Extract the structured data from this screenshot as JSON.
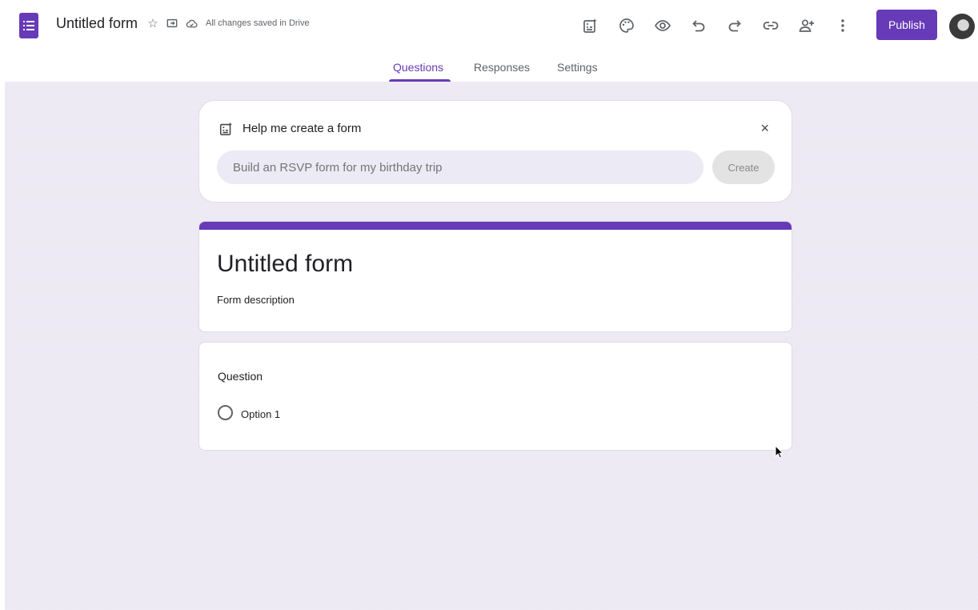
{
  "header": {
    "doc_title": "Untitled form",
    "save_status": "All changes saved in Drive",
    "publish_label": "Publish",
    "title_icons": [
      "star-icon",
      "move-to-folder-icon",
      "cloud-saved-icon"
    ],
    "tool_icons": [
      "ai-generate-icon",
      "palette-icon",
      "preview-eye-icon",
      "undo-icon",
      "redo-icon",
      "link-icon",
      "add-collaborator-icon",
      "more-vert-icon"
    ]
  },
  "tabs": [
    {
      "label": "Questions",
      "active": true
    },
    {
      "label": "Responses",
      "active": false
    },
    {
      "label": "Settings",
      "active": false
    }
  ],
  "help": {
    "title": "Help me create a form",
    "input_placeholder": "Build an RSVP form for my birthday trip",
    "create_label": "Create",
    "close_symbol": "×"
  },
  "form": {
    "title": "Untitled form",
    "description": "Form description"
  },
  "question": {
    "title": "Question",
    "options": [
      "Option 1"
    ]
  },
  "colors": {
    "accent": "#673ab7",
    "canvas": "#ede9f4"
  }
}
